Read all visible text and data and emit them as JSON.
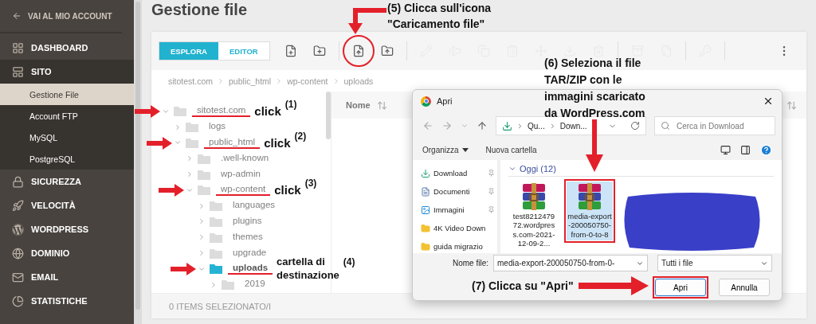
{
  "sidebar": {
    "back_link": "VAI AL MIO ACCOUNT",
    "items": [
      {
        "label": "DASHBOARD",
        "expanded": false
      },
      {
        "label": "SITO",
        "expanded": true,
        "children": [
          {
            "label": "Gestione File",
            "selected": true
          },
          {
            "label": "Account FTP",
            "selected": false
          },
          {
            "label": "MySQL",
            "selected": false
          },
          {
            "label": "PostgreSQL",
            "selected": false
          }
        ]
      },
      {
        "label": "SICUREZZA",
        "expanded": false
      },
      {
        "label": "VELOCITÀ",
        "expanded": false
      },
      {
        "label": "WORDPRESS",
        "expanded": false
      },
      {
        "label": "DOMINIO",
        "expanded": false
      },
      {
        "label": "EMAIL",
        "expanded": false
      },
      {
        "label": "STATISTICHE",
        "expanded": false
      }
    ]
  },
  "page_title": "Gestione file",
  "toolbar": {
    "tabs": [
      {
        "label": "ESPLORA",
        "selected": true
      },
      {
        "label": "EDITOR",
        "selected": false
      }
    ],
    "buttons": [
      {
        "disabled": false,
        "circled": false
      },
      {
        "disabled": false,
        "circled": false
      },
      {
        "disabled": false,
        "circled": true
      },
      {
        "disabled": false,
        "circled": false
      },
      {
        "disabled": true,
        "circled": false
      },
      {
        "disabled": true,
        "circled": false
      },
      {
        "disabled": true,
        "circled": false
      },
      {
        "disabled": true,
        "circled": false
      },
      {
        "disabled": true,
        "circled": false
      },
      {
        "disabled": true,
        "circled": false
      },
      {
        "disabled": true,
        "circled": false
      },
      {
        "disabled": true,
        "circled": false
      },
      {
        "disabled": true,
        "circled": false
      },
      {
        "disabled": true,
        "circled": false
      },
      {
        "disabled": false,
        "circled": false
      }
    ]
  },
  "breadcrumb": [
    "sitotest.com",
    "public_html",
    "wp-content",
    "uploads"
  ],
  "tree": [
    {
      "name": "sitotest.com",
      "expanded": true,
      "selected": false,
      "annotation": {
        "kind": "click",
        "text": "click",
        "step": "(1)"
      },
      "children": [
        {
          "name": "logs",
          "expanded": false,
          "selected": false
        },
        {
          "name": "public_html",
          "expanded": true,
          "selected": false,
          "annotation": {
            "kind": "click",
            "text": "click",
            "step": "(2)"
          },
          "children": [
            {
              "name": ".well-known",
              "expanded": false,
              "selected": false
            },
            {
              "name": "wp-admin",
              "expanded": false,
              "selected": false
            },
            {
              "name": "wp-content",
              "expanded": true,
              "selected": false,
              "annotation": {
                "kind": "click",
                "text": "click",
                "step": "(3)"
              },
              "children": [
                {
                  "name": "languages",
                  "expanded": false,
                  "selected": false
                },
                {
                  "name": "plugins",
                  "expanded": false,
                  "selected": false
                },
                {
                  "name": "themes",
                  "expanded": false,
                  "selected": false
                },
                {
                  "name": "upgrade",
                  "expanded": false,
                  "selected": false
                },
                {
                  "name": "uploads",
                  "expanded": true,
                  "selected": true,
                  "annotation": {
                    "kind": "note",
                    "text": "cartella di\ndestinazione",
                    "step": "(4)"
                  },
                  "children": [
                    {
                      "name": "2019",
                      "expanded": false,
                      "selected": false
                    }
                  ]
                }
              ]
            }
          ]
        }
      ]
    }
  ],
  "file_list": {
    "columns": [
      "Nome"
    ]
  },
  "footer": "0 ITEMS SELEZIONATO/I",
  "dialog": {
    "title": "Apri",
    "path": [
      "Qu...",
      "Down..."
    ],
    "search_placeholder": "Cerca in Download",
    "commands": [
      {
        "label": "Organizza",
        "dropdown": true
      },
      {
        "label": "Nuova cartella",
        "dropdown": false
      }
    ],
    "places": [
      {
        "label": "Download",
        "pinned": true
      },
      {
        "label": "Documenti",
        "pinned": true
      },
      {
        "label": "Immagini",
        "pinned": true
      },
      {
        "label": "4K Video Down",
        "pinned": false
      },
      {
        "label": "guida migrazio",
        "pinned": false
      }
    ],
    "group": "Oggi (12)",
    "files": [
      {
        "name": "test821247972.wordpress.com-2021-12-09-2...",
        "selected": false
      },
      {
        "name": "media-export-200050750-from-0-to-8",
        "selected": true
      }
    ],
    "file_name_label": "Nome file:",
    "file_name": "media-export-200050750-from-0-",
    "file_type": "Tutti i file",
    "buttons": [
      {
        "label": "Apri",
        "default": true
      },
      {
        "label": "Annulla",
        "default": false
      }
    ]
  },
  "notes": [
    {
      "text": "(5) Clicca sull'icona\n\"Caricamento file\""
    },
    {
      "text": "(6) Seleziona il file\nTAR/ZIP con le\nimmagini scaricato\nda WordPress.com"
    },
    {
      "text": "(7) Clicca su \"Apri\""
    }
  ]
}
